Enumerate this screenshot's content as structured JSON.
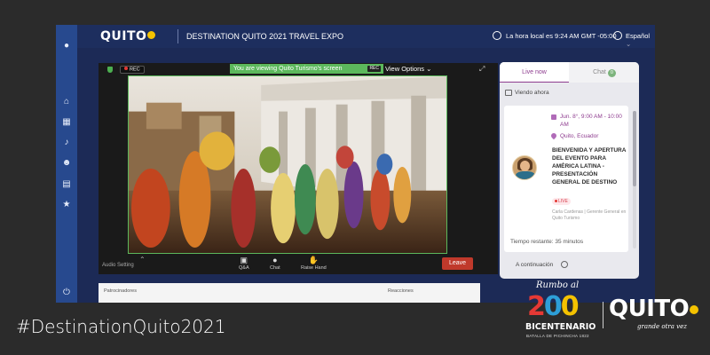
{
  "header": {
    "logo": "QUITO",
    "title": "DESTINATION QUITO 2021 TRAVEL EXPO",
    "local_time": "La hora local es 9:24 AM GMT -05:00",
    "language": "Español"
  },
  "sidebar": {
    "items": [
      {
        "name": "profile",
        "icon": "user-icon",
        "glyph": "●"
      },
      {
        "name": "home",
        "icon": "home-icon",
        "glyph": "⌂"
      },
      {
        "name": "calendar",
        "icon": "calendar-icon",
        "glyph": "▦"
      },
      {
        "name": "microphone",
        "icon": "microphone-icon",
        "glyph": "♪"
      },
      {
        "name": "people",
        "icon": "people-icon",
        "glyph": "☻"
      },
      {
        "name": "booths",
        "icon": "booth-icon",
        "glyph": "▤"
      },
      {
        "name": "favorites",
        "icon": "star-icon",
        "glyph": "★"
      },
      {
        "name": "power",
        "icon": "power-icon",
        "glyph": "⏻"
      }
    ]
  },
  "stage": {
    "rec": "REC",
    "viewing_banner": "You are viewing Quito Turismo's screen",
    "view_options": "View Options",
    "controls": {
      "audio_setting": "Audio Setting",
      "qa": "Q&A",
      "chat": "Chat",
      "raise_hand": "Raise Hand",
      "leave": "Leave"
    }
  },
  "bottom": {
    "sponsors": "Patrocinadores",
    "reactions": "Reacciones"
  },
  "panel": {
    "tabs": {
      "live_now": "Live now",
      "chat": "Chat",
      "chat_count": "0"
    },
    "watching_now": "Viendo ahora",
    "event": {
      "date": "Jun. 8°, 9:00 AM - 10:00 AM",
      "location": "Quito, Ecuador",
      "title": "BIENVENIDA Y APERTURA DEL EVENTO PARA AMÉRICA LATINA - PRESENTACIÓN GENERAL DE DESTINO",
      "live": "LIVE",
      "speaker": "Carla Cardenas | Gerente General en Quito Turismo",
      "time_left": "Tiempo restante: 35 minutos"
    },
    "next_up": "A continuación"
  },
  "branding": {
    "hashtag": "#DestinationQuito2021",
    "rumbo": "Rumbo al",
    "number": "200",
    "bicentenario": "BICENTENARIO",
    "battle": "BATALLA DE PICHINCHA 1822",
    "quito": "QUITO",
    "tagline": "grande otra vez"
  },
  "colors": {
    "app_bg": "#1c2a56",
    "sidebar": "#27498e",
    "accent_green": "#5cb85c",
    "live_purple": "#8e3c8f",
    "leave_red": "#c0392b"
  }
}
